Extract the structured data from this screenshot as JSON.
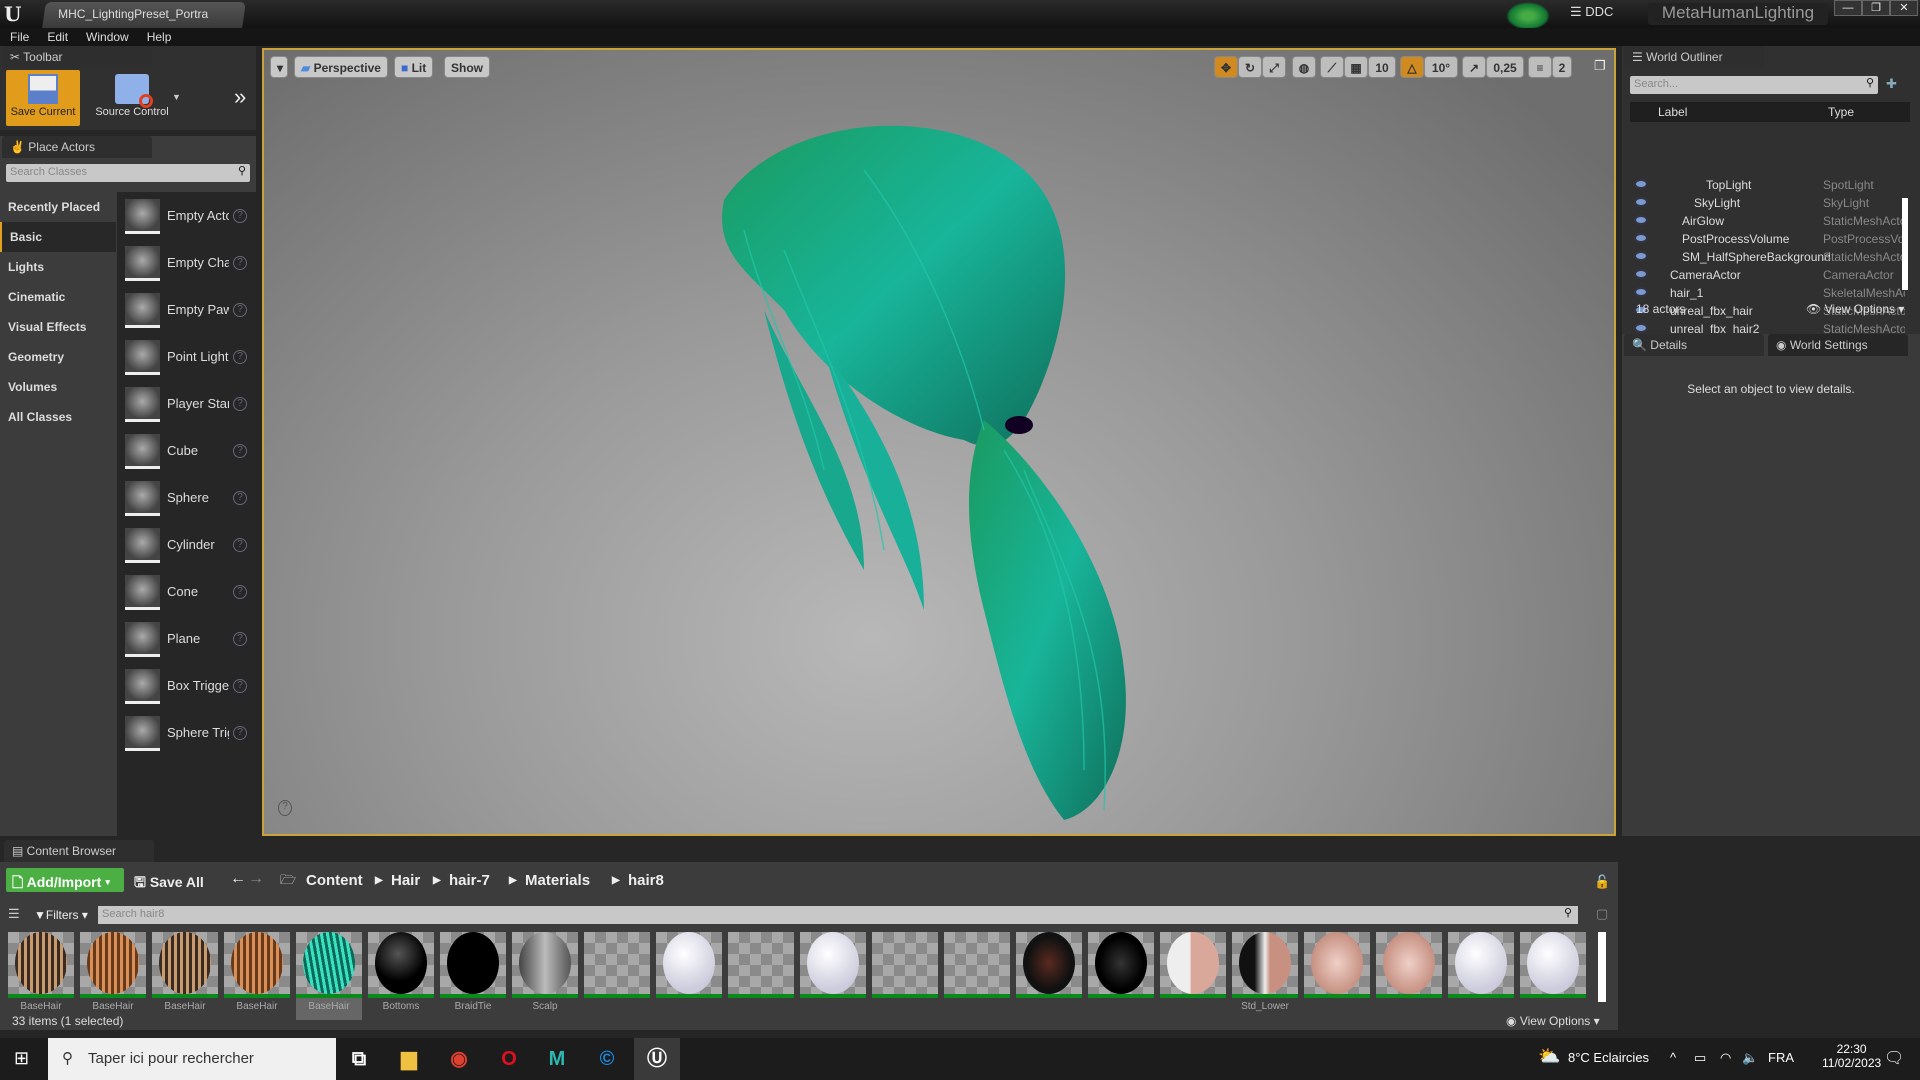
{
  "title_bar": {
    "doc_tab": "MHC_LightingPreset_Portra",
    "ddc": "DDC",
    "project": "MetaHumanLighting",
    "min": "—",
    "max": "❐",
    "close": "✕"
  },
  "menu": [
    "File",
    "Edit",
    "Window",
    "Help"
  ],
  "toolbar": {
    "tab": "Toolbar",
    "save": "Save Current",
    "source_control": "Source Control",
    "more": "»"
  },
  "place_actors": {
    "tab": "Place Actors",
    "search_placeholder": "Search Classes",
    "categories": [
      "Recently Placed",
      "Basic",
      "Lights",
      "Cinematic",
      "Visual Effects",
      "Geometry",
      "Volumes",
      "All Classes"
    ],
    "selected_category": "Basic",
    "items": [
      "Empty Actor",
      "Empty Character",
      "Empty Pawn",
      "Point Light",
      "Player Start",
      "Cube",
      "Sphere",
      "Cylinder",
      "Cone",
      "Plane",
      "Box Trigger",
      "Sphere Trigger"
    ]
  },
  "viewport": {
    "perspective": "Perspective",
    "lit": "Lit",
    "show": "Show",
    "grid_snap": "10",
    "rot_snap": "10°",
    "scale_snap": "0,25",
    "cam_speed": "2",
    "help": "?"
  },
  "outliner": {
    "tab": "World Outliner",
    "search_placeholder": "Search...",
    "col_label": "Label",
    "col_type": "Type",
    "rows": [
      {
        "label": "TopLight",
        "type": "SpotLight",
        "indent": 3
      },
      {
        "label": "SkyLight",
        "type": "SkyLight",
        "indent": 2
      },
      {
        "label": "AirGlow",
        "type": "StaticMeshActor",
        "indent": 1
      },
      {
        "label": "PostProcessVolume",
        "type": "PostProcessVolume",
        "indent": 1
      },
      {
        "label": "SM_HalfSphereBackground",
        "type": "StaticMeshActor",
        "indent": 1
      },
      {
        "label": "CameraActor",
        "type": "CameraActor",
        "indent": 0
      },
      {
        "label": "hair_1",
        "type": "SkeletalMeshActor",
        "indent": 0
      },
      {
        "label": "unreal_fbx_hair",
        "type": "StaticMeshActor",
        "indent": 0
      },
      {
        "label": "unreal_fbx_hair2",
        "type": "StaticMeshActor",
        "indent": 0
      }
    ],
    "count": "18 actors",
    "view_options": "View Options"
  },
  "details": {
    "tab": "Details",
    "world_settings": "World Settings",
    "empty": "Select an object to view details."
  },
  "content_browser": {
    "tab": "Content Browser",
    "add_import": "Add/Import",
    "save_all": "Save All",
    "path": [
      "Content",
      "Hair",
      "hair-7",
      "Materials",
      "hair8"
    ],
    "filters": "Filters",
    "search_placeholder": "Search hair8",
    "assets": [
      {
        "label": "BaseHair",
        "kind": "hairb"
      },
      {
        "label": "BaseHair",
        "kind": "hairo"
      },
      {
        "label": "BaseHair",
        "kind": "hairb"
      },
      {
        "label": "BaseHair",
        "kind": "hairo"
      },
      {
        "label": "BaseHair",
        "kind": "hairt",
        "selected": true
      },
      {
        "label": "Bottoms",
        "kind": "black"
      },
      {
        "label": "BraidTie",
        "kind": "black2"
      },
      {
        "label": "Scalp",
        "kind": "grey"
      },
      {
        "label": "",
        "kind": "checker"
      },
      {
        "label": "",
        "kind": "white"
      },
      {
        "label": "",
        "kind": "checker"
      },
      {
        "label": "",
        "kind": "white"
      },
      {
        "label": "",
        "kind": "checker"
      },
      {
        "label": "",
        "kind": "checker"
      },
      {
        "label": "",
        "kind": "eye"
      },
      {
        "label": "",
        "kind": "eye2"
      },
      {
        "label": "",
        "kind": "skinw"
      },
      {
        "label": "Std_Lower",
        "kind": "skind"
      },
      {
        "label": "",
        "kind": "skin"
      },
      {
        "label": "",
        "kind": "skin"
      },
      {
        "label": "",
        "kind": "white"
      },
      {
        "label": "",
        "kind": "white"
      }
    ],
    "status": "33 items (1 selected)",
    "view_options": "View Options"
  },
  "taskbar": {
    "search": "Taper ici pour rechercher",
    "weather": "8°C  Eclaircies",
    "lang": "FRA",
    "time": "22:30",
    "date": "11/02/2023"
  }
}
